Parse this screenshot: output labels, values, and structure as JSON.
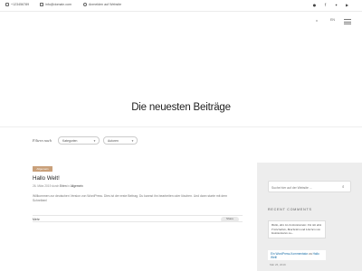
{
  "topbar": {
    "phone": "+123456789",
    "email": "info@domain.com",
    "login": "Anmelden auf Website",
    "social_icons": [
      "pinterest-icon",
      "facebook-icon",
      "twitter-icon",
      "youtube-icon"
    ]
  },
  "header": {
    "lang": "EN"
  },
  "hero": {
    "title": "Die neuesten Beiträge"
  },
  "filters": {
    "label": "Filtern nach",
    "category": "Kategorien",
    "author": "Autoren"
  },
  "post": {
    "category": "Allgemein",
    "title": "Hallo Welt!",
    "date": "26. März 2019",
    "by": "durch",
    "author": "Erlen",
    "in": "in",
    "category_link": "Allgemein",
    "excerpt": "Willkommen zur deutschen Version von WordPress. Dies ist der erste Beitrag. Du kannst ihn bearbeiten oder löschen. Und dann starte mit dem Schreiben!",
    "more": "Mehr",
    "share": "Share"
  },
  "sidebar": {
    "search_placeholder": "Suche hier auf der Website ...",
    "recent_comments_title": "RECENT COMMENTS",
    "comment_text": "Hallo, dies ist ein Kommentar. Um mit dem Freischalten, Bearbeiten und Löschen von Kommentaren zu...",
    "comment_author": "Ein WordPress-Kommentator",
    "comment_on": "zu",
    "comment_post": "Hallo Welt!",
    "comment_date": "Mär 26, 2019"
  }
}
